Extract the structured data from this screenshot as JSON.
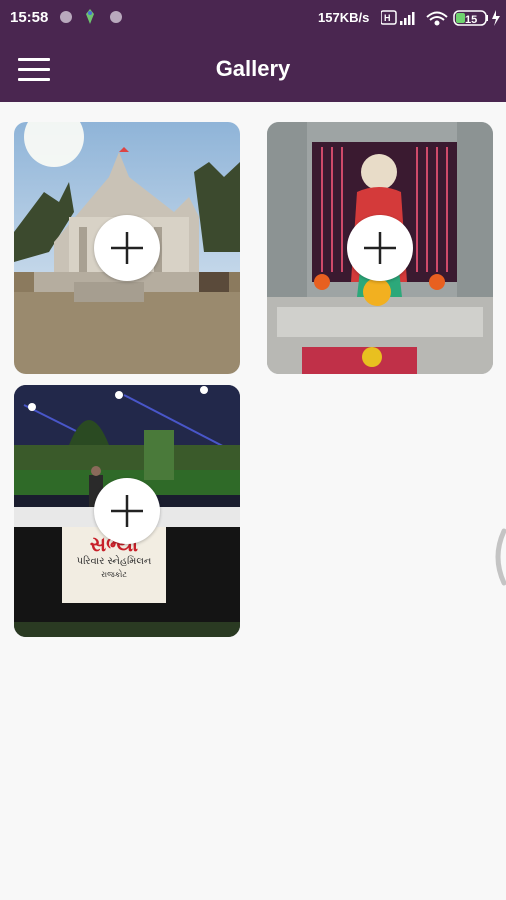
{
  "status_bar": {
    "time": "15:58",
    "network_speed": "157KB/s",
    "battery_level": "15"
  },
  "app_bar": {
    "title": "Gallery"
  },
  "gallery": {
    "photos": [
      {
        "description_icon": "photo-thumbnail"
      },
      {
        "description_icon": "photo-thumbnail"
      },
      {
        "description_icon": "photo-thumbnail",
        "sign_line1": "સભ્યો",
        "sign_line2": "પરિવાર સ્નેહમિલન",
        "sign_line3": "રાજકોટ"
      }
    ]
  },
  "colors": {
    "primary": "#4a2650",
    "background": "#f8f8f8"
  }
}
